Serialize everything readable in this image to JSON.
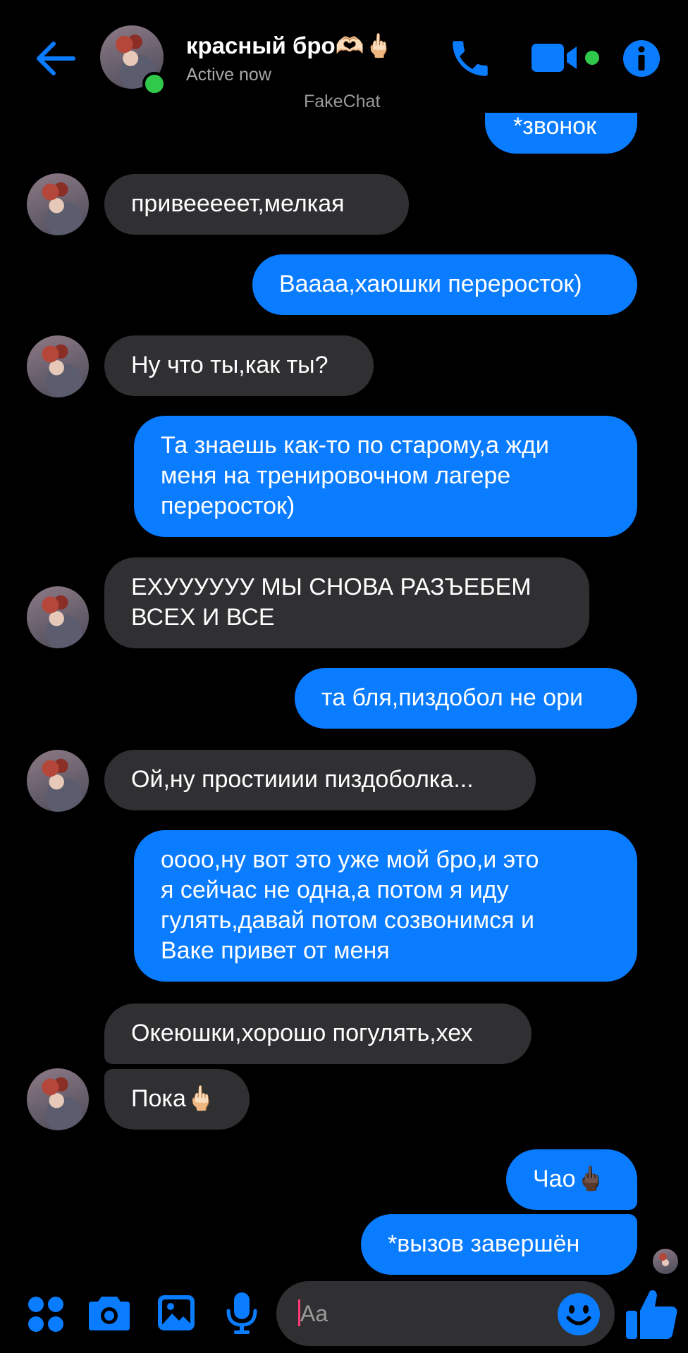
{
  "header": {
    "contact_name": "красный бро🫶🏻🖕🏻",
    "status": "Active now",
    "watermark": "FakeChat"
  },
  "messages": [
    {
      "side": "out",
      "text": "*звонок"
    },
    {
      "side": "in",
      "text": "привееееет,мелкая"
    },
    {
      "side": "out",
      "text": "Ваааа,хаюшки переросток)"
    },
    {
      "side": "in",
      "text": "Ну что ты,как ты?"
    },
    {
      "side": "out",
      "text": "Та знаешь как-то по старому,а жди\nменя на тренировочном лагере\nпереросток)"
    },
    {
      "side": "in",
      "text": "ЕХУУУУУУ МЫ СНОВА РАЗЪЕБЕМ\nВСЕХ И ВСЕ"
    },
    {
      "side": "out",
      "text": "та бля,пиздобол не ори"
    },
    {
      "side": "in",
      "text": "Ой,ну простииии пиздоболка..."
    },
    {
      "side": "out",
      "text": "оооо,ну вот это уже мой бро,и это\nя сейчас не одна,а потом я иду\nгулять,давай потом созвонимся и\nВаке привет от меня"
    },
    {
      "side": "in",
      "text": "Океюшки,хорошо погулять,хех"
    },
    {
      "side": "in",
      "text": "Пока🖕🏻"
    },
    {
      "side": "out",
      "text": "Чао🖕🏿"
    },
    {
      "side": "out",
      "text": "*вызов завершён"
    }
  ],
  "composer": {
    "placeholder": "Aa"
  },
  "colors": {
    "accent": "#0a7cff",
    "incoming_bubble": "#303033",
    "online": "#31c94b",
    "background": "#000000"
  },
  "icons": {
    "back": "arrow-left-icon",
    "call": "phone-icon",
    "video": "video-camera-icon",
    "info": "info-icon",
    "menu": "four-dots-icon",
    "camera": "camera-icon",
    "gallery": "image-icon",
    "mic": "microphone-icon",
    "emoji": "smiley-icon",
    "like": "thumbs-up-icon"
  }
}
